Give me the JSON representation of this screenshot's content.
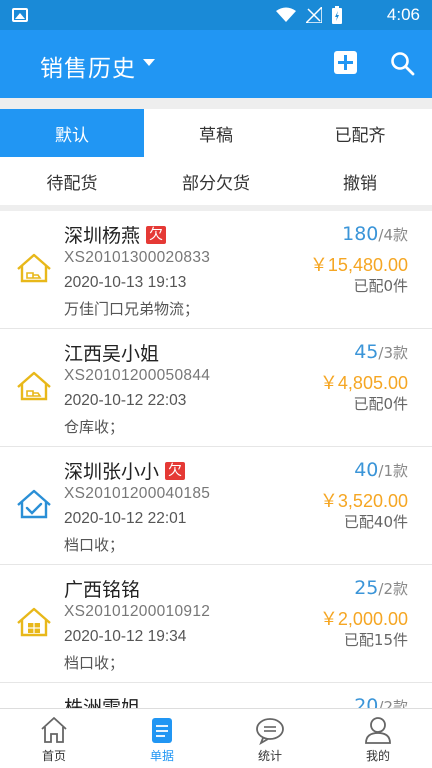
{
  "status_bar": {
    "time": "4:06"
  },
  "app_bar": {
    "title": "销售历史"
  },
  "tabs_row1": [
    {
      "label": "默认",
      "active": true
    },
    {
      "label": "草稿",
      "active": false
    },
    {
      "label": "已配齐",
      "active": false
    }
  ],
  "tabs_row2": [
    {
      "label": "待配货"
    },
    {
      "label": "部分欠货"
    },
    {
      "label": "撤销"
    }
  ],
  "orders": [
    {
      "customer": "深圳杨燕",
      "owe_badge": "欠",
      "order_no": "XS20101300020833",
      "time": "2020-10-13 19:13",
      "note": "万佳门口兄弟物流；",
      "qty": "180",
      "kinds": "/4款",
      "amount": "￥15,480.00",
      "shipped": "已配0件",
      "icon": "house-truck-icon"
    },
    {
      "customer": "江西吴小姐",
      "owe_badge": "",
      "order_no": "XS20101200050844",
      "time": "2020-10-12 22:03",
      "note": "仓库收；",
      "qty": "45",
      "kinds": "/3款",
      "amount": "￥4,805.00",
      "shipped": "已配0件",
      "icon": "house-truck-icon"
    },
    {
      "customer": "深圳张小小",
      "owe_badge": "欠",
      "order_no": "XS20101200040185",
      "time": "2020-10-12 22:01",
      "note": "档口收；",
      "qty": "40",
      "kinds": "/1款",
      "amount": "￥3,520.00",
      "shipped": "已配40件",
      "icon": "house-check-icon"
    },
    {
      "customer": "广西铭铭",
      "owe_badge": "",
      "order_no": "XS20101200010912",
      "time": "2020-10-12 19:34",
      "note": "档口收；",
      "qty": "25",
      "kinds": "/2款",
      "amount": "￥2,000.00",
      "shipped": "已配15件",
      "icon": "house-partial-icon"
    },
    {
      "customer": "株洲雷姐",
      "owe_badge": "",
      "order_no": "",
      "time": "",
      "note": "",
      "qty": "20",
      "kinds": "/2款",
      "amount": "",
      "shipped": "",
      "icon": "house-truck-icon"
    }
  ],
  "bottom_nav": [
    {
      "label": "首页",
      "icon": "home-icon",
      "active": false
    },
    {
      "label": "单据",
      "icon": "document-icon",
      "active": true
    },
    {
      "label": "统计",
      "icon": "chat-icon",
      "active": false
    },
    {
      "label": "我的",
      "icon": "person-icon",
      "active": false
    }
  ],
  "colors": {
    "primary": "#2196f3",
    "amount": "#f5a623",
    "owe": "#e53935",
    "qty": "#3b95d8"
  }
}
